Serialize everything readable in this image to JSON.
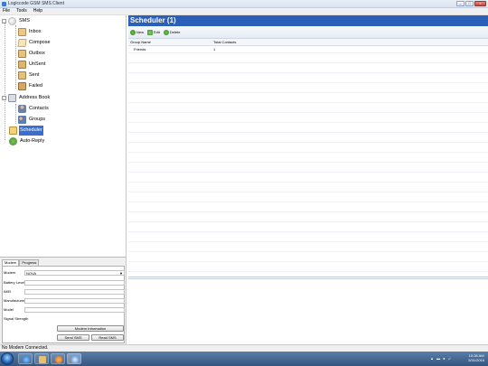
{
  "window": {
    "title": "Logiccode GSM SMS Client"
  },
  "menu": [
    "File",
    "Tools",
    "Help"
  ],
  "tree": {
    "sms": "SMS",
    "inbox": "Inbox",
    "compose": "Compose",
    "outbox": "Outbox",
    "unsent": "UnSent",
    "sent": "Sent",
    "failed": "Failed",
    "address_book": "Address Book",
    "contacts": "Contacts",
    "groups": "Groups",
    "scheduler": "Scheduler",
    "auto_reply": "Auto-Reply"
  },
  "modem_panel": {
    "tabs": [
      "Modem",
      "Progress"
    ],
    "labels": {
      "modem": "Modem",
      "battery": "Battery Level",
      "imei": "IMEI",
      "manufacturer": "Manufacturer",
      "model": "Model",
      "signal": "Signal Strength"
    },
    "modem_value": "NOVA",
    "buttons": {
      "modem_info": "Modem Information",
      "send_sms": "Send SMS",
      "read_sms": "Read SMS"
    }
  },
  "main": {
    "header_title": "Scheduler (1)",
    "toolbar": {
      "new": "New",
      "edit": "Edit",
      "delete": "Delete"
    },
    "columns": [
      "Group Name",
      "Total Contacts"
    ],
    "rows": [
      {
        "group": "Friends",
        "total": "1"
      }
    ]
  },
  "status": {
    "text": "No Modem Connected."
  },
  "taskbar": {
    "time": "10:28 AM",
    "date": "5/31/2016"
  },
  "colors": {
    "header_blue": "#2c5fb8",
    "selection_blue": "#3a6fd0",
    "taskbar_blue": "#34557f"
  }
}
